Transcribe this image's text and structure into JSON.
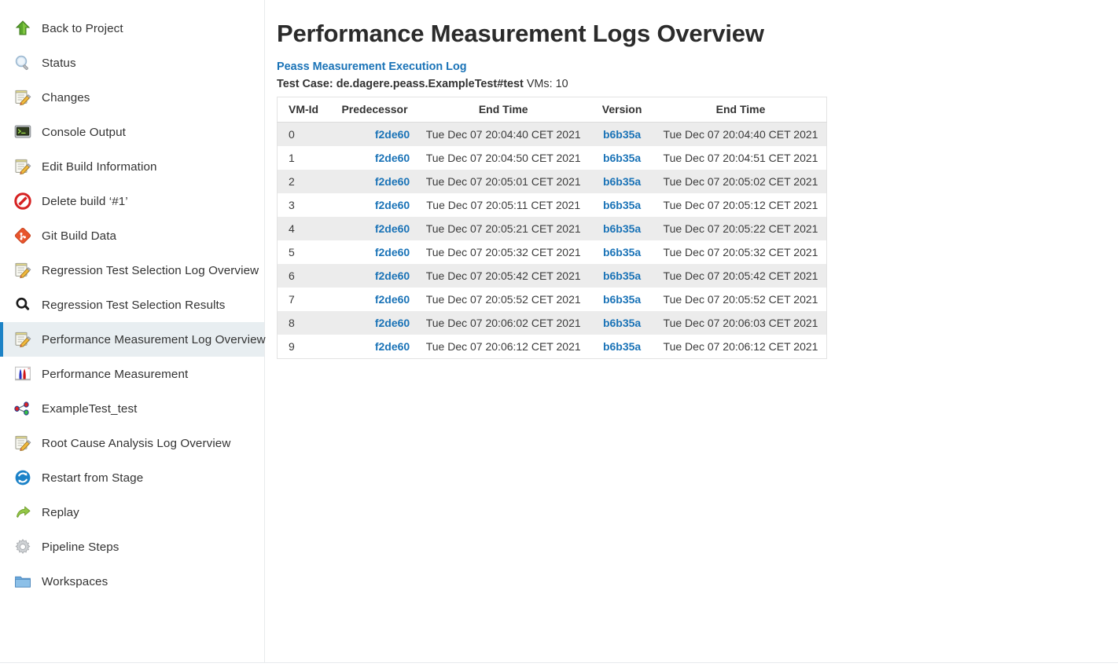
{
  "sidebar": {
    "items": [
      {
        "label": "Back to Project",
        "icon": "up-arrow-icon",
        "selected": false
      },
      {
        "label": "Status",
        "icon": "magnifier-icon",
        "selected": false
      },
      {
        "label": "Changes",
        "icon": "notepad-pencil-icon",
        "selected": false
      },
      {
        "label": "Console Output",
        "icon": "terminal-icon",
        "selected": false
      },
      {
        "label": "Edit Build Information",
        "icon": "notepad-pencil-icon",
        "selected": false
      },
      {
        "label": "Delete build ‘#1’",
        "icon": "delete-forbidden-icon",
        "selected": false
      },
      {
        "label": "Git Build Data",
        "icon": "git-icon",
        "selected": false
      },
      {
        "label": "Regression Test Selection Log Overview",
        "icon": "notepad-pencil-icon",
        "selected": false
      },
      {
        "label": "Regression Test Selection Results",
        "icon": "search-bold-icon",
        "selected": false
      },
      {
        "label": "Performance Measurement Log Overview",
        "icon": "notepad-pencil-icon",
        "selected": true
      },
      {
        "label": "Performance Measurement",
        "icon": "histogram-icon",
        "selected": false
      },
      {
        "label": "ExampleTest_test",
        "icon": "node-graph-icon",
        "selected": false
      },
      {
        "label": "Root Cause Analysis Log Overview",
        "icon": "notepad-pencil-icon",
        "selected": false
      },
      {
        "label": "Restart from Stage",
        "icon": "restart-circle-icon",
        "selected": false
      },
      {
        "label": "Replay",
        "icon": "replay-arrow-icon",
        "selected": false
      },
      {
        "label": "Pipeline Steps",
        "icon": "gear-icon",
        "selected": false
      },
      {
        "label": "Workspaces",
        "icon": "folder-icon",
        "selected": false
      }
    ]
  },
  "main": {
    "page_title": "Performance Measurement Logs Overview",
    "exec_log_link": "Peass Measurement Execution Log",
    "testcase_label": "Test Case: de.dagere.peass.ExampleTest#test",
    "vms_label": "VMs: 10",
    "table": {
      "headers": [
        "VM-Id",
        "Predecessor",
        "End Time",
        "Version",
        "End Time"
      ],
      "rows": [
        {
          "vmid": "0",
          "predecessor": "f2de60",
          "end_time_pred": "Tue Dec 07 20:04:40 CET 2021",
          "version": "b6b35a",
          "end_time_ver": "Tue Dec 07 20:04:40 CET 2021"
        },
        {
          "vmid": "1",
          "predecessor": "f2de60",
          "end_time_pred": "Tue Dec 07 20:04:50 CET 2021",
          "version": "b6b35a",
          "end_time_ver": "Tue Dec 07 20:04:51 CET 2021"
        },
        {
          "vmid": "2",
          "predecessor": "f2de60",
          "end_time_pred": "Tue Dec 07 20:05:01 CET 2021",
          "version": "b6b35a",
          "end_time_ver": "Tue Dec 07 20:05:02 CET 2021"
        },
        {
          "vmid": "3",
          "predecessor": "f2de60",
          "end_time_pred": "Tue Dec 07 20:05:11 CET 2021",
          "version": "b6b35a",
          "end_time_ver": "Tue Dec 07 20:05:12 CET 2021"
        },
        {
          "vmid": "4",
          "predecessor": "f2de60",
          "end_time_pred": "Tue Dec 07 20:05:21 CET 2021",
          "version": "b6b35a",
          "end_time_ver": "Tue Dec 07 20:05:22 CET 2021"
        },
        {
          "vmid": "5",
          "predecessor": "f2de60",
          "end_time_pred": "Tue Dec 07 20:05:32 CET 2021",
          "version": "b6b35a",
          "end_time_ver": "Tue Dec 07 20:05:32 CET 2021"
        },
        {
          "vmid": "6",
          "predecessor": "f2de60",
          "end_time_pred": "Tue Dec 07 20:05:42 CET 2021",
          "version": "b6b35a",
          "end_time_ver": "Tue Dec 07 20:05:42 CET 2021"
        },
        {
          "vmid": "7",
          "predecessor": "f2de60",
          "end_time_pred": "Tue Dec 07 20:05:52 CET 2021",
          "version": "b6b35a",
          "end_time_ver": "Tue Dec 07 20:05:52 CET 2021"
        },
        {
          "vmid": "8",
          "predecessor": "f2de60",
          "end_time_pred": "Tue Dec 07 20:06:02 CET 2021",
          "version": "b6b35a",
          "end_time_ver": "Tue Dec 07 20:06:03 CET 2021"
        },
        {
          "vmid": "9",
          "predecessor": "f2de60",
          "end_time_pred": "Tue Dec 07 20:06:12 CET 2021",
          "version": "b6b35a",
          "end_time_ver": "Tue Dec 07 20:06:12 CET 2021"
        }
      ]
    }
  },
  "colors": {
    "link": "#1a73b7",
    "selected_bg": "#e8eef1",
    "selected_accent": "#1d83c6",
    "row_stripe": "#ececec",
    "border": "#e3e3e3",
    "title": "#2b2b2b"
  }
}
